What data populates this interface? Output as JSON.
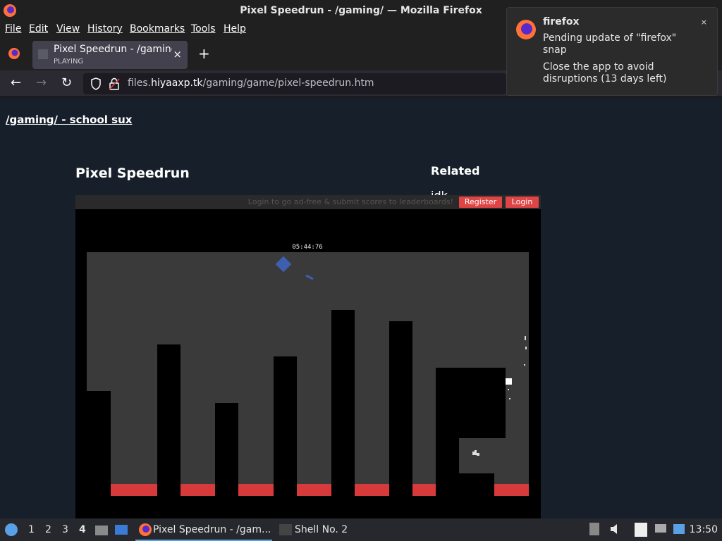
{
  "window": {
    "title": "Pixel Speedrun - /gaming/ — Mozilla Firefox"
  },
  "menu": [
    "File",
    "Edit",
    "View",
    "History",
    "Bookmarks",
    "Tools",
    "Help"
  ],
  "tab": {
    "title": "Pixel Speedrun - /gaming",
    "subtitle": "PLAYING",
    "close": "×",
    "new": "+"
  },
  "url": {
    "host_pre": "files.",
    "host": "hiyaaxp.tk",
    "path": "/gaming/game/pixel-speedrun.htm"
  },
  "page": {
    "site_header": "/gaming/ - school sux",
    "game_title": "Pixel Speedrun",
    "related_heading": "Related",
    "related_item": "idk"
  },
  "game": {
    "banner_text": "Login to go ad-free & submit scores to leaderboards!",
    "register": "Register",
    "login": "Login",
    "timer": "05:44:76"
  },
  "notification": {
    "app": "firefox",
    "line1": "Pending update of \"firefox\" snap",
    "line2": "Close the app to avoid disruptions (13 days left)",
    "close": "×"
  },
  "taskbar": {
    "workspaces": [
      "1",
      "2",
      "3",
      "4"
    ],
    "active_workspace": "4",
    "apps": [
      {
        "label": "Pixel Speedrun - /gam..."
      },
      {
        "label": "Shell No. 2"
      }
    ],
    "clock": "13:50"
  }
}
